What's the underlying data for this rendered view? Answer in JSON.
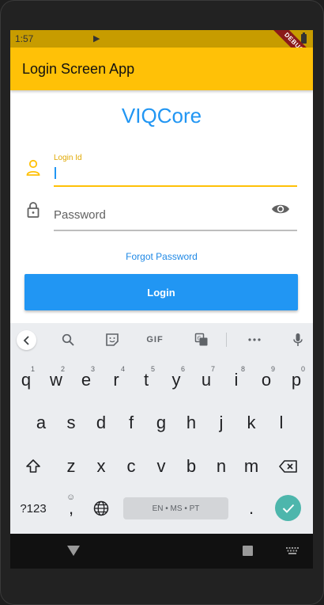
{
  "status": {
    "time": "1:57",
    "debug": "DEBUG"
  },
  "app": {
    "title": "Login Screen App",
    "brand": "VIQCore"
  },
  "form": {
    "login_label": "Login Id",
    "login_value": "",
    "password_placeholder": "Password",
    "forgot_label": "Forgot Password",
    "login_button": "Login"
  },
  "keyboard": {
    "toolbar": [
      "back-icon",
      "search-icon",
      "sticker-icon",
      "GIF",
      "translate-icon",
      "more-icon",
      "mic-icon"
    ],
    "gif_label": "GIF",
    "rows": [
      [
        "q",
        "w",
        "e",
        "r",
        "t",
        "y",
        "u",
        "i",
        "o",
        "p"
      ],
      [
        "a",
        "s",
        "d",
        "f",
        "g",
        "h",
        "j",
        "k",
        "l"
      ],
      [
        "z",
        "x",
        "c",
        "v",
        "b",
        "n",
        "m"
      ]
    ],
    "hints": [
      "1",
      "2",
      "3",
      "4",
      "5",
      "6",
      "7",
      "8",
      "9",
      "0"
    ],
    "symbols_key": "?123",
    "comma_key": ",",
    "comma_hint": "☺",
    "space_label": "EN • MS • PT",
    "period_key": "."
  },
  "colors": {
    "accent": "#ffc107",
    "status_bar": "#c79c00",
    "brand": "#2196f3",
    "button": "#2196f3",
    "enter": "#4db6ac"
  }
}
